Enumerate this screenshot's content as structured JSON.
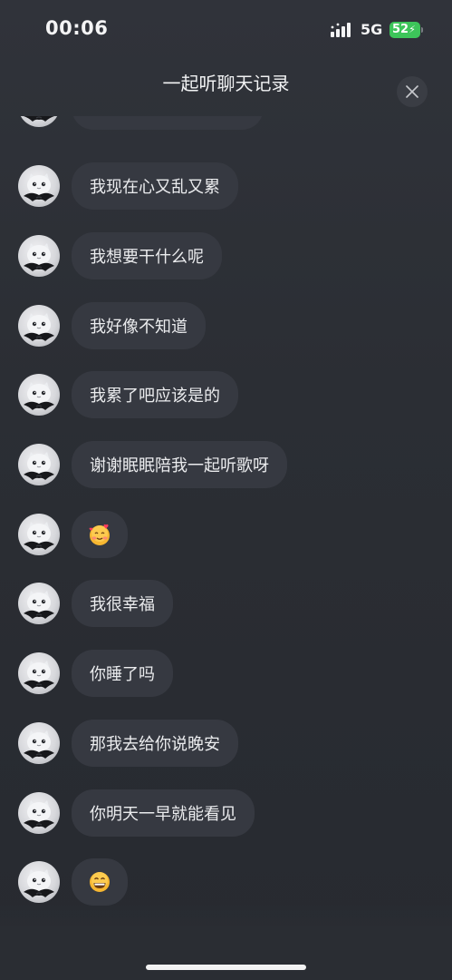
{
  "status_bar": {
    "time": "00:06",
    "network": "5G",
    "battery": "52"
  },
  "header": {
    "title": "一起听聊天记录"
  },
  "messages": [
    {
      "type": "text",
      "text": "我现在心又乱又累"
    },
    {
      "type": "text",
      "text": "我想要干什么呢"
    },
    {
      "type": "text",
      "text": "我好像不知道"
    },
    {
      "type": "text",
      "text": "我累了吧应该是的"
    },
    {
      "type": "text",
      "text": "谢谢眠眠陪我一起听歌呀"
    },
    {
      "type": "emoji",
      "icon": "smiling-face-with-hearts-icon"
    },
    {
      "type": "text",
      "text": "我很幸福"
    },
    {
      "type": "text",
      "text": "你睡了吗"
    },
    {
      "type": "text",
      "text": "那我去给你说晚安"
    },
    {
      "type": "text",
      "text": "你明天一早就能看见"
    },
    {
      "type": "emoji",
      "icon": "grinning-face-icon"
    }
  ],
  "colors": {
    "background": "#2b2e34",
    "bubble": "#363941",
    "battery": "#3dc55a"
  }
}
